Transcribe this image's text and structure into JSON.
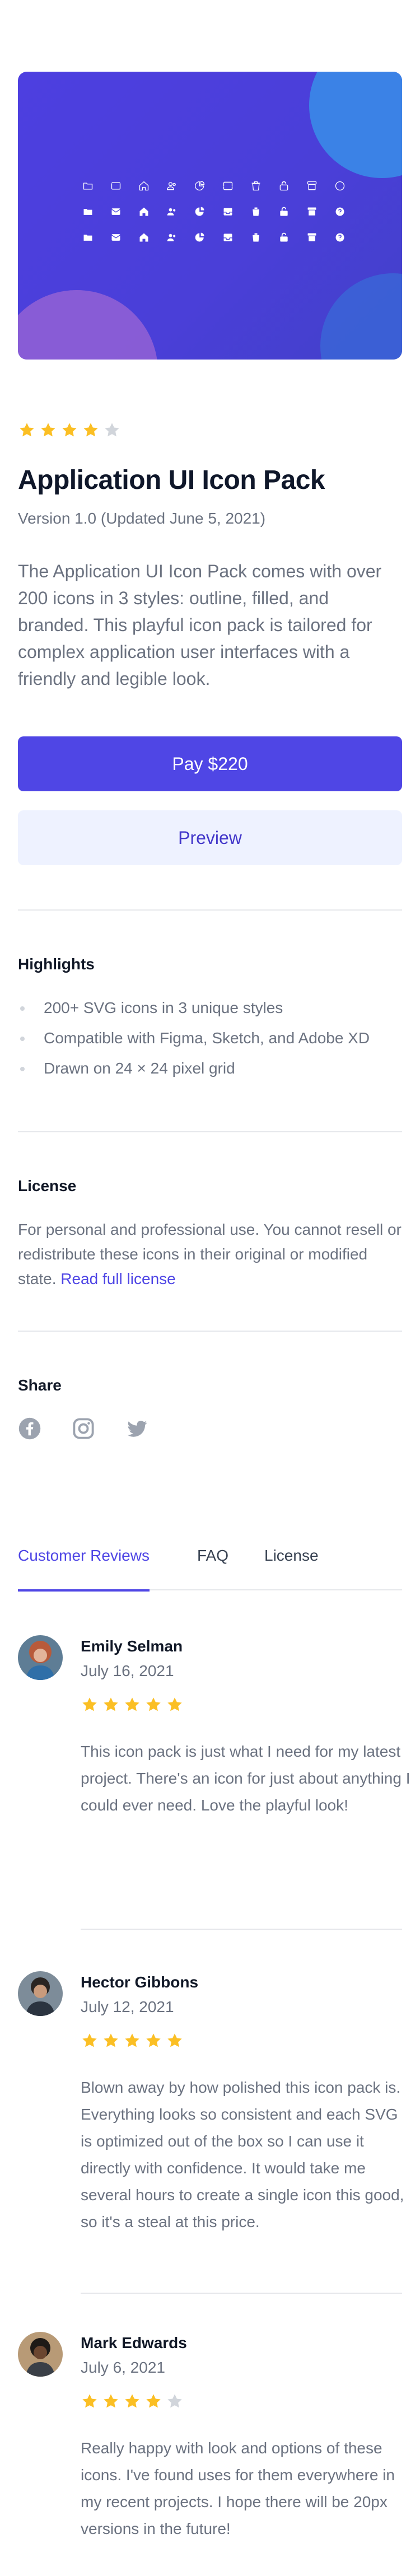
{
  "product": {
    "rating": 4,
    "rating_max": 5,
    "title": "Application UI Icon Pack",
    "version": "Version 1.0 (Updated June 5, 2021)",
    "description": "The Application UI Icon Pack comes with over 200 icons in 3 styles: outline, filled, and branded. This playful icon pack is tailored for complex application user interfaces with a friendly and legible look.",
    "pay_label": "Pay $220",
    "preview_label": "Preview"
  },
  "hero": {
    "icons": [
      "folder-icon",
      "mail-icon",
      "home-icon",
      "users-icon",
      "chart-pie-icon",
      "inbox-icon",
      "trash-icon",
      "lock-open-icon",
      "archive-icon",
      "question-icon"
    ]
  },
  "highlights": {
    "title": "Highlights",
    "items": [
      "200+ SVG icons in 3 unique styles",
      "Compatible with Figma, Sketch, and Adobe XD",
      "Drawn on 24 × 24 pixel grid"
    ]
  },
  "license": {
    "title": "License",
    "text": "For personal and professional use. You cannot resell or redistribute these icons in their original or modified state.",
    "link": "Read full license"
  },
  "share": {
    "title": "Share",
    "icons": [
      "facebook-icon",
      "instagram-icon",
      "twitter-icon"
    ]
  },
  "tabs": [
    "Customer Reviews",
    "FAQ",
    "License"
  ],
  "reviews": [
    {
      "name": "Emily Selman",
      "date": "July 16, 2021",
      "rating": 5,
      "text": "This icon pack is just what I need for my latest project. There's an icon for just about anything I could ever need. Love the playful look!"
    },
    {
      "name": "Hector Gibbons",
      "date": "July 12, 2021",
      "rating": 5,
      "text": "Blown away by how polished this icon pack is. Everything looks so consistent and each SVG is optimized out of the box so I can use it directly with confidence. It would take me several hours to create a single icon this good, so it's a steal at this price."
    },
    {
      "name": "Mark Edwards",
      "date": "July 6, 2021",
      "rating": 4,
      "text": "Really happy with look and options of these icons. I've found uses for them everywhere in my recent projects. I hope there will be 20px versions in the future!"
    }
  ],
  "colors": {
    "accent": "#4f46e5",
    "star_filled": "#fbbf24",
    "star_empty": "#d1d5db"
  }
}
